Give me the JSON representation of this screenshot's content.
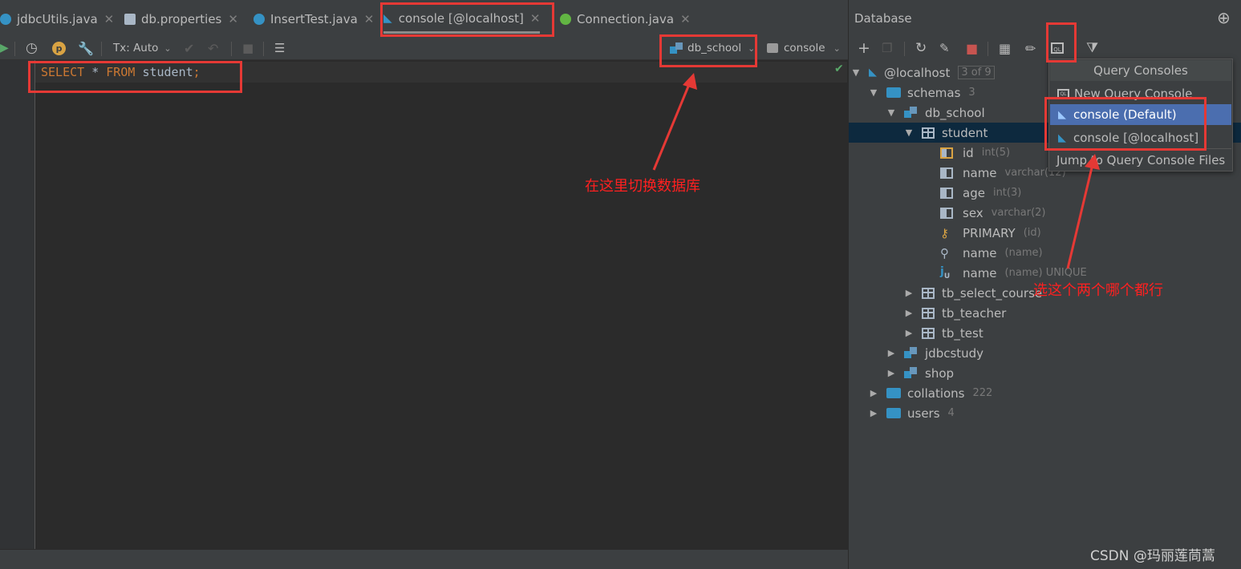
{
  "tabs": [
    {
      "label": "jdbcUtils.java",
      "icon": "java-class-icon",
      "color": "#3592c4"
    },
    {
      "label": "db.properties",
      "icon": "properties-file-icon",
      "color": "#a9b7c6"
    },
    {
      "label": "InsertTest.java",
      "icon": "java-class-icon",
      "color": "#3592c4"
    },
    {
      "label": "console [@localhost]",
      "icon": "mysql-console-icon",
      "color": "#3592c4",
      "active": true
    },
    {
      "label": "Connection.java",
      "icon": "java-interface-icon",
      "color": "#62b543"
    }
  ],
  "toolbar": {
    "tx_mode": "Tx: Auto",
    "schema_selector": "db_school",
    "console_selector": "console"
  },
  "editor": {
    "code": {
      "select": "SELECT",
      "star": "*",
      "from": "FROM",
      "table": "student",
      "semicolon": ";"
    }
  },
  "db_panel": {
    "title": "Database",
    "tree": [
      {
        "label": "@localhost",
        "count": "3 of 9"
      },
      {
        "label": "schemas",
        "count": "3"
      },
      {
        "label": "db_school"
      },
      {
        "label": "student"
      },
      {
        "label": "id",
        "type": "int(5)"
      },
      {
        "label": "name",
        "type": "varchar(12)"
      },
      {
        "label": "age",
        "type": "int(3)"
      },
      {
        "label": "sex",
        "type": "varchar(2)"
      },
      {
        "label": "PRIMARY",
        "type": "(id)"
      },
      {
        "label": "name",
        "type": "(name)"
      },
      {
        "label": "name",
        "type": "(name) UNIQUE"
      },
      {
        "label": "tb_select_course"
      },
      {
        "label": "tb_teacher"
      },
      {
        "label": "tb_test"
      },
      {
        "label": "jdbcstudy"
      },
      {
        "label": "shop"
      },
      {
        "label": "collations",
        "count": "222"
      },
      {
        "label": "users",
        "count": "4"
      }
    ]
  },
  "popup": {
    "title": "Query Consoles",
    "items": [
      "New Query Console",
      "console (Default)",
      "console [@localhost]",
      "Jump to Query Console Files"
    ],
    "selected_color": "#4b6eaf"
  },
  "annotations": {
    "switch_db": "在这里切换数据库",
    "choose_either": "选这个两个哪个都行",
    "color": "#e53935"
  },
  "watermark": "CSDN @玛丽莲茼蒿"
}
